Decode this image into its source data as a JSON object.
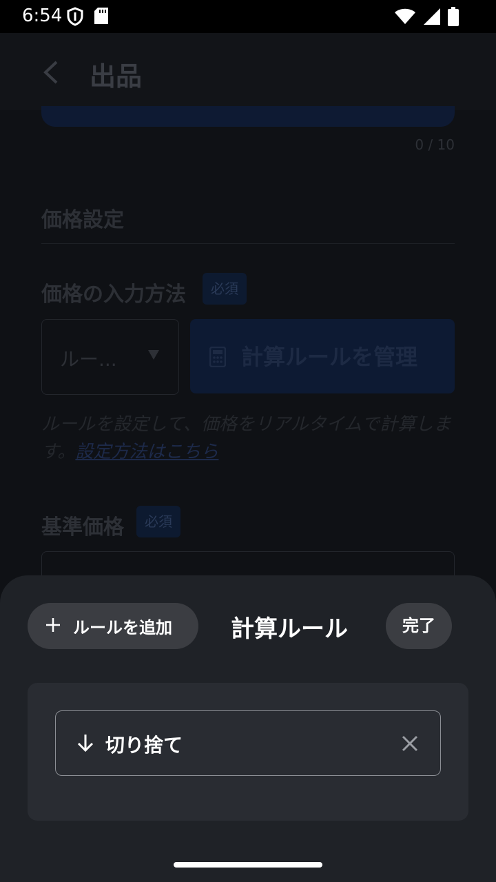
{
  "status_bar": {
    "time": "6:54"
  },
  "header": {
    "title": "出品"
  },
  "description_counter": "0 / 10",
  "price_section": {
    "title": "価格設定",
    "input_method_label": "価格の入力方法",
    "required_badge": "必須",
    "method_dropdown_value": "ルー...",
    "manage_rules_label": "計算ルールを管理",
    "helper_text": "ルールを設定して、価格をリアルタイムで計算します。",
    "helper_link": "設定方法はこちら",
    "base_price_label": "基準価格",
    "base_price_badge": "必須"
  },
  "sheet": {
    "add_rule_label": "ルールを追加",
    "title": "計算ルール",
    "done_label": "完了",
    "rules": [
      {
        "label": "切り捨て",
        "icon": "arrow-down-icon"
      }
    ]
  },
  "colors": {
    "sheet_bg": "#1f2227",
    "chip_bg": "#3b3d42",
    "accent_dim": "#0d1a33"
  }
}
